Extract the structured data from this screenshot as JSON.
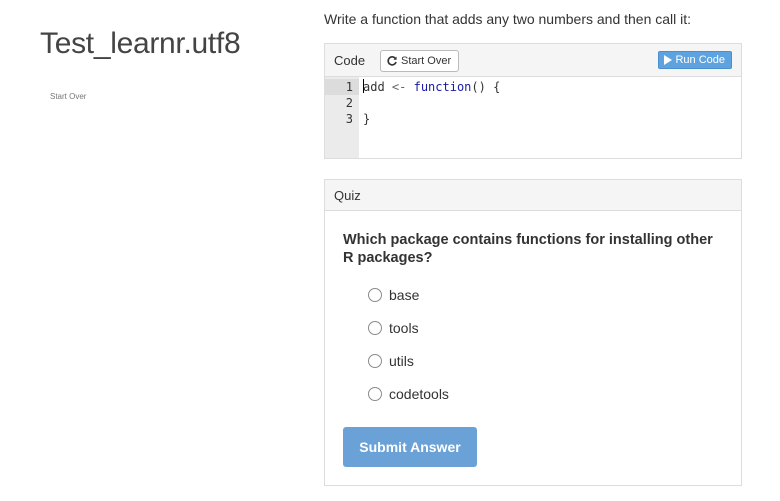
{
  "sidebar": {
    "title": "Test_learnr.utf8",
    "start_over": "Start Over"
  },
  "exercise": {
    "prompt": "Write a function that adds any two numbers and then call it:",
    "header_label": "Code",
    "start_over_label": "Start Over",
    "run_code_label": "Run Code",
    "lines": [
      {
        "number": "1",
        "name": "add",
        "arrow": " <- ",
        "keyword": "function",
        "rest": "() {"
      },
      {
        "number": "2",
        "text": ""
      },
      {
        "number": "3",
        "text": "}"
      }
    ]
  },
  "quiz": {
    "header_label": "Quiz",
    "question": "Which package contains functions for installing other R packages?",
    "options": [
      "base",
      "tools",
      "utils",
      "codetools"
    ],
    "submit_label": "Submit Answer"
  },
  "colors": {
    "run_button": "#5ea3e0",
    "submit_button": "#6aa2d8",
    "keyword": "#1a1aa6"
  }
}
